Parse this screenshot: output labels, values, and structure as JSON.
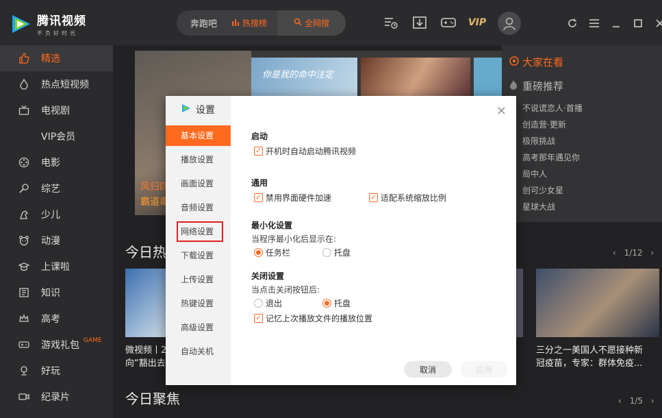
{
  "app": {
    "title": "腾讯视频",
    "slogan": "不负好时光"
  },
  "search": {
    "value": "奔跑吧",
    "hot_label": "热搜榜",
    "all_label": "全网搜"
  },
  "top_icons": [
    "history-list-icon",
    "download-icon",
    "game-controller-icon",
    "vip-icon"
  ],
  "vip_label": "VIP",
  "sidebar": {
    "items": [
      {
        "label": "精选",
        "icon": "thumbs-up-icon",
        "active": true
      },
      {
        "label": "热点短视频",
        "icon": "flame-icon"
      },
      {
        "label": "电视剧",
        "icon": "tv-icon"
      },
      {
        "label": "VIP会员",
        "icon": ""
      },
      {
        "label": "电影",
        "icon": "film-reel-icon"
      },
      {
        "label": "综艺",
        "icon": "microphone-icon"
      },
      {
        "label": "少儿",
        "icon": "child-icon"
      },
      {
        "label": "动漫",
        "icon": "bear-icon"
      },
      {
        "label": "上课啦",
        "icon": "graduation-icon"
      },
      {
        "label": "知识",
        "icon": "book-icon"
      },
      {
        "label": "高考",
        "icon": "crown-icon"
      },
      {
        "label": "游戏礼包",
        "icon": "gamepad-icon",
        "badge": "GAME"
      },
      {
        "label": "好玩",
        "icon": "trophy-icon"
      },
      {
        "label": "纪录片",
        "icon": "camera-icon"
      }
    ]
  },
  "banner": {
    "caption1": "风归四",
    "caption2": "霸道毒",
    "thumb_text": "你是我的命中注定"
  },
  "right_panel": {
    "heading": "大家在看",
    "subheading": "重磅推荐",
    "items": [
      "不说谎恋人·首播",
      "创造营·更新",
      "极限挑战",
      "高考那年遇见你",
      "局中人",
      "创可少女星",
      "星球大战"
    ]
  },
  "section1": {
    "title": "今日热",
    "pager": "1/12"
  },
  "section2": {
    "title": "今日聚焦",
    "pager": "1/5"
  },
  "videos": {
    "left_caption_line1": "微视频丨2",
    "left_caption_line2": "向“豁出去",
    "right_caption_line1": "三分之一美国人不愿接种新",
    "right_caption_line2": "冠疫苗，专家：群体免疫..."
  },
  "dialog": {
    "title": "设置",
    "tabs": [
      "基本设置",
      "播放设置",
      "画面设置",
      "音频设置",
      "网络设置",
      "下载设置",
      "上传设置",
      "热键设置",
      "高级设置",
      "自动关机"
    ],
    "startup": {
      "title": "启动",
      "option": "开机时自动启动腾讯视频"
    },
    "general": {
      "title": "通用",
      "opt1": "禁用界面硬件加速",
      "opt2": "适配系统缩放比例"
    },
    "minimize": {
      "title": "最小化设置",
      "desc": "当程序最小化后显示在:",
      "opt1": "任务栏",
      "opt2": "托盘"
    },
    "close": {
      "title": "关闭设置",
      "desc": "当点击关闭按钮后:",
      "opt1": "退出",
      "opt2": "托盘",
      "remember": "记忆上次播放文件的播放位置"
    },
    "cancel": "取消",
    "apply": "应用"
  },
  "colors": {
    "accent": "#ff6a1e",
    "bg": "#2b2b2d"
  }
}
